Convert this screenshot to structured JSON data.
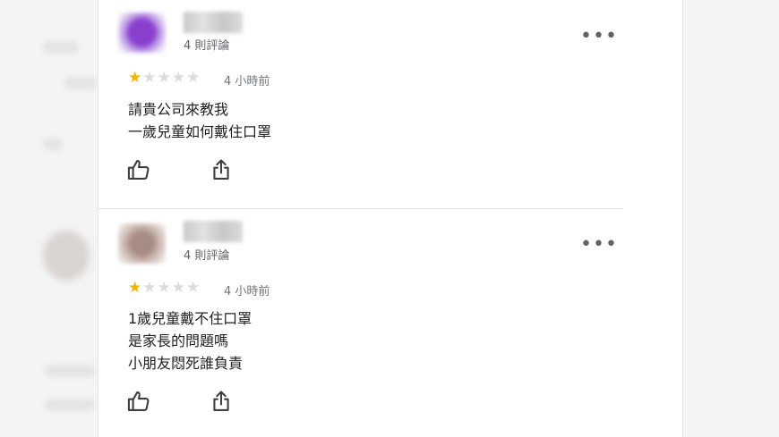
{
  "reviews": [
    {
      "review_count": "4 則評論",
      "rating": 1,
      "max_rating": 5,
      "time": "4 小時前",
      "lines": [
        "請貴公司來教我",
        "一歲兒童如何戴住口罩"
      ],
      "more_icon": "more-horizontal-icon",
      "like_icon": "thumbs-up-icon",
      "share_icon": "share-icon"
    },
    {
      "review_count": "4 則評論",
      "rating": 1,
      "max_rating": 5,
      "time": "4 小時前",
      "lines": [
        "1歲兒童戴不住口罩",
        "是家長的問題嗎",
        "小朋友悶死誰負責"
      ],
      "more_icon": "more-horizontal-icon",
      "like_icon": "thumbs-up-icon",
      "share_icon": "share-icon"
    }
  ],
  "colors": {
    "star_filled": "#f6b400",
    "star_empty": "#dadce0",
    "text": "#202124",
    "secondary_text": "#70757a"
  }
}
